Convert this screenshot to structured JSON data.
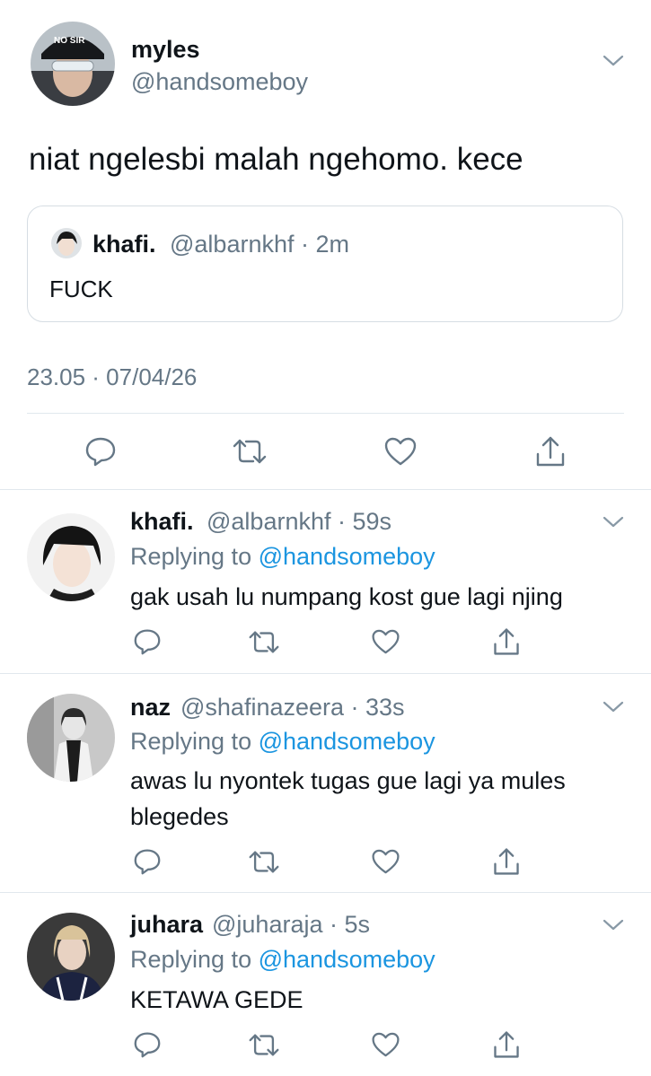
{
  "main_tweet": {
    "name": "myles",
    "handle": "@handsomeboy",
    "avatar_cap_text": "NO SIR",
    "text": "niat ngelesbi malah ngehomo. kece",
    "quoted": {
      "name": "khafi.",
      "meta": "@albarnkhf · 2m",
      "text": "FUCK"
    },
    "timestamp": "23.05 · 07/04/26",
    "actions": [
      "reply-icon",
      "retweet-icon",
      "like-icon",
      "share-icon"
    ]
  },
  "replies": [
    {
      "name": "khafi.",
      "meta": "@albarnkhf · 59s",
      "replying_prefix": "Replying to",
      "replying_handle": "@handsomeboy",
      "text": "gak usah lu numpang kost gue lagi njing"
    },
    {
      "name": "naz",
      "meta": "@shafinazeera · 33s",
      "replying_prefix": "Replying to",
      "replying_handle": "@handsomeboy",
      "text": "awas lu nyontek tugas gue lagi ya mules blegedes"
    },
    {
      "name": "juhara",
      "meta": "@juharaja · 5s",
      "replying_prefix": "Replying to",
      "replying_handle": "@handsomeboy",
      "text": "KETAWA GEDE"
    }
  ],
  "colors": {
    "link": "#1b95e0",
    "secondary": "#657786",
    "divider": "#e1e8ed"
  }
}
